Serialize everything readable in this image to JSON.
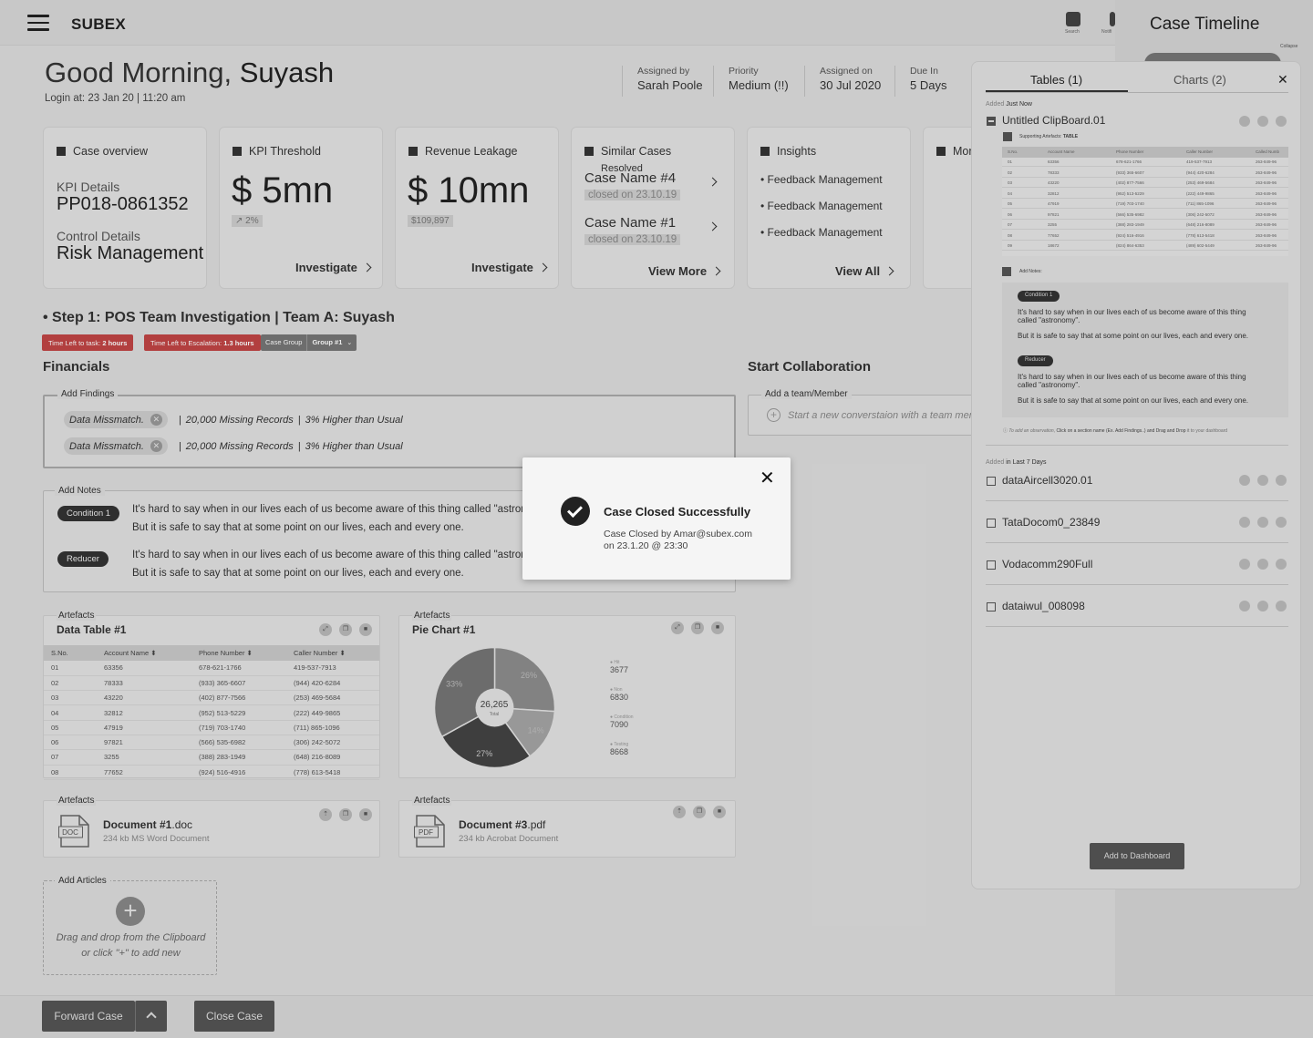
{
  "app": {
    "logo": "SUBEX"
  },
  "topbar": {
    "search_label": "Search",
    "notif_label": "Notifi"
  },
  "greeting": {
    "prefix": "Good Morning,",
    "name": "Suyash",
    "login": "Login at:  23 Jan 20 | 11:20 am"
  },
  "meta": [
    {
      "key": "Assigned by",
      "value": "Sarah Poole"
    },
    {
      "key": "Priority",
      "value": "Medium (!!)"
    },
    {
      "key": "Assigned on",
      "value": "30 Jul 2020"
    },
    {
      "key": "Due In",
      "value": "5 Days"
    }
  ],
  "cards": {
    "overview": {
      "title": "Case overview",
      "kpi_label": "KPI Details",
      "kpi_value": "PP018-0861352",
      "ctrl_label": "Control Details",
      "ctrl_value": "Risk Management"
    },
    "kpi": {
      "title": "KPI Threshold",
      "value": "$ 5mn",
      "delta": "↗ 2%",
      "link": "Investigate"
    },
    "revenue": {
      "title": "Revenue Leakage",
      "value": "$ 10mn",
      "delta": "$109,897",
      "link": "Investigate"
    },
    "similar": {
      "title": "Similar Cases",
      "status": "Resolved",
      "items": [
        {
          "name": "Case Name #4",
          "closed": "closed on 23.10.19"
        },
        {
          "name": "Case Name #1",
          "closed": "closed on 23.10.19"
        }
      ],
      "link": "View More"
    },
    "insights": {
      "title": "Insights",
      "items": [
        "• Feedback Management",
        "• Feedback Management",
        "• Feedback Management"
      ],
      "link": "View All"
    },
    "more": {
      "title": "Mor"
    }
  },
  "step": {
    "title": "• Step 1: POS Team Investigation |  Team A: Suyash",
    "tag1_label": "Time Left to task:",
    "tag1_value": "2 hours",
    "tag2_label": "Time Left to Escalation:",
    "tag2_value": "1.3 hours",
    "group_label": "Case Group",
    "group_value": "Group #1"
  },
  "financials": {
    "title": "Financials",
    "findings_label": "Add Findings",
    "findings": [
      {
        "chip": "Data Missmatch.",
        "text1": "20,000 Missing Records",
        "text2": "3% Higher than Usual"
      },
      {
        "chip": "Data Missmatch.",
        "text1": "20,000 Missing Records",
        "text2": "3% Higher than Usual"
      }
    ]
  },
  "collab": {
    "title": "Start Collaboration",
    "label": "Add a team/Member",
    "placeholder": "Start a new converstaion with a  team member"
  },
  "notes": {
    "label": "Add Notes",
    "items": [
      {
        "tag": "Condition 1",
        "line1": "It's hard to say when in our lives each of us become aware of this thing called \"astronomy\".",
        "line2": "But it is safe to say that at some point on our lives, each and every one."
      },
      {
        "tag": "Reducer",
        "line1": "It's hard to say when in our lives each of us become aware of this thing called \"astronomy\".",
        "line2": "But it is safe to say that at some point on our lives, each and every one."
      }
    ]
  },
  "artefacts": {
    "label": "Artefacts",
    "table": {
      "title": "Data Table #1",
      "columns": [
        "S.No.",
        "Account Name",
        "Phone Number",
        "Caller Number"
      ],
      "rows": [
        [
          "01",
          "63356",
          "678-621-1766",
          "419-537-7913"
        ],
        [
          "02",
          "78333",
          "(933) 365-6607",
          "(944) 420-6284"
        ],
        [
          "03",
          "43220",
          "(402) 877-7566",
          "(253) 469-5684"
        ],
        [
          "04",
          "32812",
          "(952) 513-5229",
          "(222) 449-9865"
        ],
        [
          "05",
          "47919",
          "(719) 703-1740",
          "(711) 865-1096"
        ],
        [
          "06",
          "97821",
          "(566) 535-6982",
          "(306) 242-5072"
        ],
        [
          "07",
          "3255",
          "(388) 283-1949",
          "(648) 216-8089"
        ],
        [
          "08",
          "77652",
          "(924) 516-4916",
          "(778) 613-5418"
        ]
      ]
    },
    "pie": {
      "title": "Pie Chart #1",
      "center": "26,265",
      "center_sub": "Total"
    },
    "doc1": {
      "name": "Document #1",
      "ext": ".doc",
      "sub": "234 kb MS Word Document",
      "icon": "DOC"
    },
    "doc2": {
      "name": "Document #3",
      "ext": ".pdf",
      "sub": "234 kb Acrobat Document",
      "icon": "PDF"
    }
  },
  "chart_data": {
    "type": "pie",
    "slices": [
      {
        "label": "26%",
        "value": 26
      },
      {
        "label": "14%",
        "value": 14
      },
      {
        "label": "27%",
        "value": 27
      },
      {
        "label": "33%",
        "value": 33
      }
    ],
    "legend": [
      {
        "name": "Hit",
        "value": "3677"
      },
      {
        "name": "Non",
        "value": "6830"
      },
      {
        "name": "Condition",
        "value": "7090"
      },
      {
        "name": "Testing",
        "value": "8668"
      }
    ],
    "colors": [
      "#8e8e8e",
      "#a5a5a5",
      "#444444",
      "#767676"
    ]
  },
  "articles": {
    "label": "Add Articles",
    "line1": "Drag and drop from the Clipboard",
    "line2": "or click \"+\" to add new"
  },
  "footer": {
    "forward": "Forward Case",
    "close": "Close Case"
  },
  "timeline": {
    "title": "Case Timeline",
    "collapse": "Collapse"
  },
  "panel": {
    "tab1": "Tables (1)",
    "tab2": "Charts (2)",
    "added_prefix": "Added",
    "added_now": "Just Now",
    "clip_name": "Untitled ClipBoard.01",
    "supporting": "Supporting Artefacts:",
    "supporting_type": "TABLE",
    "columns": [
      "S.No.",
      "Account Name",
      "Phone Number",
      "Caller Number",
      "Called Numb"
    ],
    "rows": [
      [
        "01",
        "63356",
        "678-621-1766",
        "419-537-7913",
        "263-849-96"
      ],
      [
        "02",
        "78333",
        "(933) 365-6607",
        "(944) 420-6284",
        "263-849-96"
      ],
      [
        "03",
        "43220",
        "(402) 877-7566",
        "(253) 469-5684",
        "263-849-96"
      ],
      [
        "04",
        "32812",
        "(952) 513-5229",
        "(222) 449-9865",
        "263-849-96"
      ],
      [
        "05",
        "47919",
        "(719) 703-1740",
        "(711) 865-1096",
        "263-849-96"
      ],
      [
        "06",
        "97821",
        "(566) 535-6982",
        "(306) 242-5072",
        "263-849-96"
      ],
      [
        "07",
        "3255",
        "(388) 283-1949",
        "(648) 216-8089",
        "263-849-96"
      ],
      [
        "08",
        "77652",
        "(924) 516-4916",
        "(778) 613-5418",
        "263-849-96"
      ],
      [
        "09",
        "18672",
        "(824) 864-6353",
        "(489) 602-5449",
        "263-849-96"
      ]
    ],
    "add_notes": "Add Notes:",
    "notes": [
      {
        "tag": "Condition 1",
        "line1": "It's hard to say when in our lives each of us become aware of this thing",
        "line1b": "called \"astronomy\".",
        "line2": "But it is safe to say that at some point on our lives, each and every one."
      },
      {
        "tag": "Reducer",
        "line1": "It's hard to say when in our lives each of us become aware of this thing",
        "line1b": "called \"astronomy\".",
        "line2": "But it is safe to say that at some point on our lives, each and every one."
      }
    ],
    "hint_pre": "To add an observation,",
    "hint_mid": "Click on a section name (Ex. Add Findings..) and Drag and Drop",
    "hint_post": "it to your dashboard",
    "added_last": "in Last 7 Days",
    "items": [
      "dataAircell3020.01",
      "TataDocom0_23849",
      "Vodacomm290Full",
      "dataiwul_008098"
    ],
    "add_button": "Add to Dashboard"
  },
  "modal": {
    "title": "Case Closed Successfully",
    "line1": "Case Closed by Amar@subex.com",
    "line2": "on 23.1.20 @ 23:30"
  }
}
